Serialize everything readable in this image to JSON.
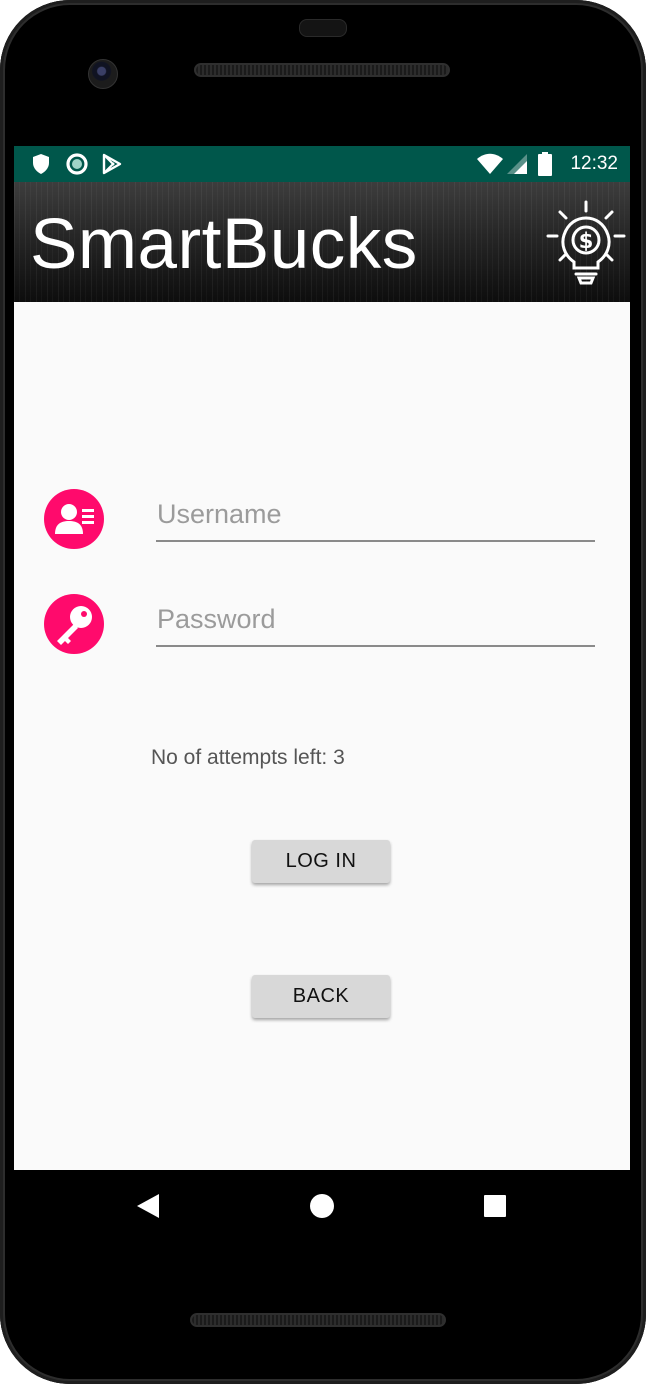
{
  "status_bar": {
    "time": "12:32",
    "left_icons": [
      "shield-icon",
      "sync-circle-icon",
      "play-store-icon"
    ],
    "right_icons": [
      "wifi-icon",
      "signal-icon",
      "battery-icon"
    ]
  },
  "header": {
    "title": "SmartBucks",
    "logo_icon": "lightbulb-dollar-icon"
  },
  "login": {
    "username": {
      "icon": "user-card-icon",
      "placeholder": "Username",
      "value": ""
    },
    "password": {
      "icon": "key-icon",
      "placeholder": "Password",
      "value": ""
    },
    "attempts_text": "No of attempts left: 3",
    "login_label": "LOG IN",
    "back_label": "BACK"
  },
  "nav_bar": {
    "items": [
      "back-triangle-icon",
      "home-circle-icon",
      "recents-square-icon"
    ]
  },
  "colors": {
    "status_bar": "#00574b",
    "accent": "#ff0a6c",
    "screen_bg": "#fafafa",
    "button_bg": "#d8d8d8"
  }
}
